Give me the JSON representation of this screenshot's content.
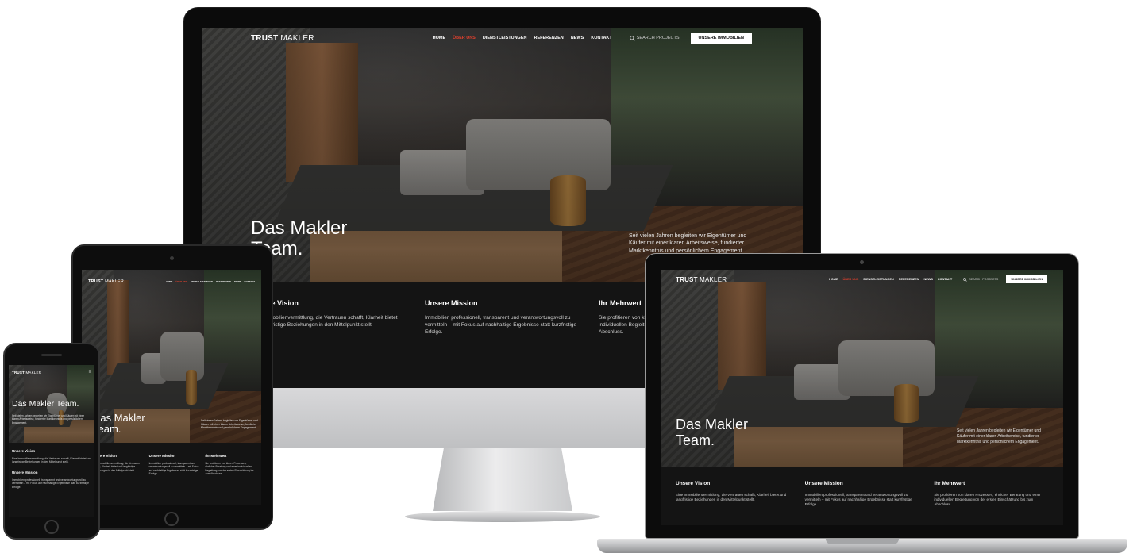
{
  "site": {
    "logo_bold": "TRUST",
    "logo_thin": "MAKLER",
    "nav": [
      "HOME",
      "ÜBER UNS",
      "DIENSTLEISTUNGEN",
      "REFERENZEN",
      "NEWS",
      "KONTAKT"
    ],
    "active_nav": "ÜBER UNS",
    "search_label": "SEARCH PROJECTS",
    "cta_label": "UNSERE IMMOBILIEN",
    "hero_title_line1": "Das Makler",
    "hero_title_line2": "Team.",
    "hero_title_full": "Das Makler Team.",
    "hero_text": "Seit vielen Jahren begleiten wir Eigentümer und Käufer mit einer klaren Arbeitsweise, fundierter Marktkenntnis und persönlichem Engagement.",
    "features": [
      {
        "title": "Unsere Vision",
        "text": "Eine Immobilienvermittlung, die Vertrauen schafft, Klarheit bietet und langfristige Beziehungen in den Mittelpunkt stellt."
      },
      {
        "title": "Unsere Mission",
        "text": "Immobilien professionell, transparent und verantwortungsvoll zu vermitteln – mit Fokus auf nachhaltige Ergebnisse statt kurzfristige Erfolge."
      },
      {
        "title": "Ihr Mehrwert",
        "text": "Sie profitieren von klaren Prozessen, ehrlicher Beratung und einer individuellen Begleitung von der ersten Einschätzung bis zum Abschluss."
      }
    ]
  },
  "colors": {
    "accent": "#e0402e",
    "background": "#141414",
    "cta_bg": "#ffffff"
  },
  "icons": {
    "search": "search-icon",
    "menu": "hamburger-menu-icon"
  }
}
